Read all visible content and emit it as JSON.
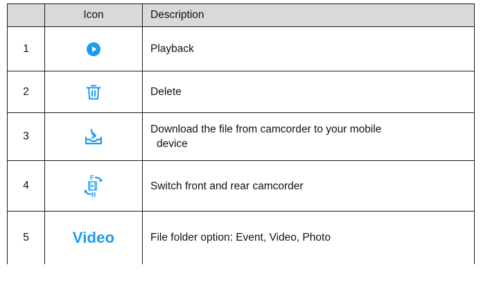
{
  "header": {
    "col_num": "",
    "col_icon": "Icon",
    "col_desc": "Description"
  },
  "rows": [
    {
      "num": "1",
      "icon": "playback-icon",
      "desc": "Playback"
    },
    {
      "num": "2",
      "icon": "trash-icon",
      "desc": "Delete"
    },
    {
      "num": "3",
      "icon": "download-tray-icon",
      "desc_line1": "Download the file from camcorder to your mobile",
      "desc_line2": "device"
    },
    {
      "num": "4",
      "icon": "switch-camera-icon",
      "icon_label_front": "F",
      "icon_label_rear": "R",
      "desc": "Switch front and rear camcorder"
    },
    {
      "num": "5",
      "icon_text": "Video",
      "desc": "File folder option: Event, Video, Photo"
    }
  ],
  "colors": {
    "accent": "#1a9cf0",
    "header_bg": "#d9d9d9",
    "border": "#1a1a1a"
  }
}
